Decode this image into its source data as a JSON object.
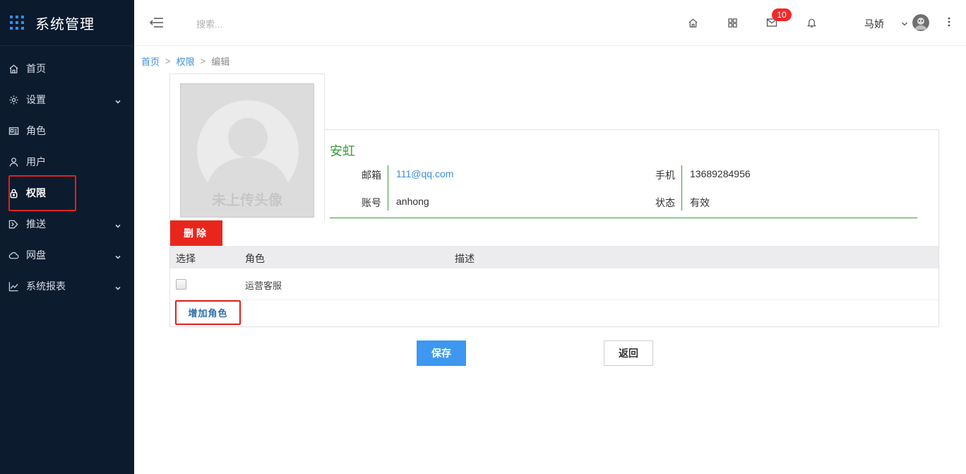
{
  "app": {
    "title": "系统管理"
  },
  "sidebar": {
    "items": [
      {
        "label": "首页",
        "icon": "home-icon"
      },
      {
        "label": "设置",
        "icon": "gear-icon"
      },
      {
        "label": "角色",
        "icon": "id-card-icon"
      },
      {
        "label": "用户",
        "icon": "user-icon"
      },
      {
        "label": "权限",
        "icon": "lock-icon"
      },
      {
        "label": "推送",
        "icon": "send-icon"
      },
      {
        "label": "网盘",
        "icon": "cloud-icon"
      },
      {
        "label": "系统报表",
        "icon": "chart-line-icon"
      }
    ],
    "active_index": 4
  },
  "header": {
    "search_placeholder": "搜索...",
    "mail_badge": "10",
    "username": "马娇"
  },
  "breadcrumb": {
    "home": "首页",
    "section": "权限",
    "current": "编辑",
    "separator": ">"
  },
  "profile": {
    "photo_placeholder": "未上传头像",
    "name": "安虹",
    "email_label": "邮箱",
    "email": "111@qq.com",
    "phone_label": "手机",
    "phone": "13689284956",
    "account_label": "账号",
    "account": "anhong",
    "status_label": "状态",
    "status": "有效"
  },
  "actions": {
    "delete": "删除",
    "add_role": "增加角色",
    "save": "保存",
    "back": "返回"
  },
  "role_table": {
    "headers": [
      "选择",
      "角色",
      "描述"
    ],
    "rows": [
      {
        "role": "运营客服",
        "description": "",
        "checked": false
      }
    ]
  },
  "colors": {
    "sidebar_bg": "#0d1b2e",
    "accent_blue": "#3e98f0",
    "danger_red": "#e9261c",
    "profile_green": "#3a9b3a"
  }
}
